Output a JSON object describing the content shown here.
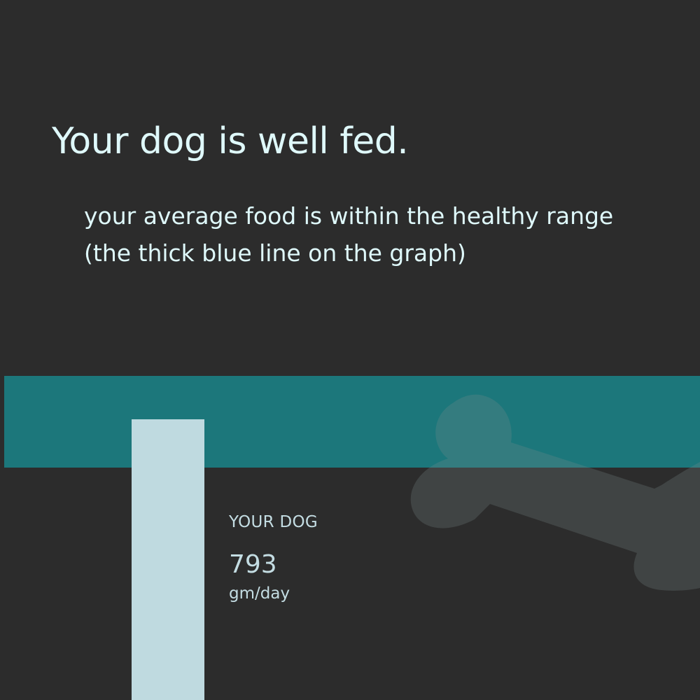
{
  "headline": "Your dog is well fed.",
  "subtext": {
    "line1": "your average food is within the healthy range",
    "line2": "(the thick blue line on the graph)"
  },
  "dog": {
    "label": "YOUR DOG",
    "value": "793",
    "unit": "gm/day"
  },
  "colors": {
    "background": "#2c2c2c",
    "text": "#dff9fb",
    "healthy_range_band": "#1c777b",
    "dog_bar": "#bfdae0",
    "bone_icon": "#7a8b8c"
  },
  "icons": {
    "background": "bone-icon"
  }
}
